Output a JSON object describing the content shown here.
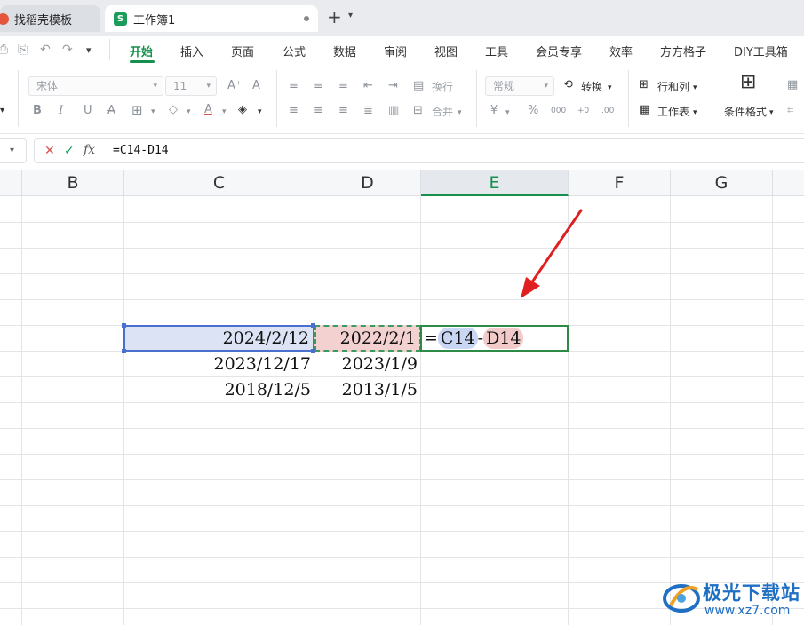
{
  "tabs": [
    {
      "label": "找稻壳模板"
    },
    {
      "label": "工作簿1",
      "icon_text": "S"
    }
  ],
  "menu": [
    "开始",
    "插入",
    "页面",
    "公式",
    "数据",
    "审阅",
    "视图",
    "工具",
    "会员专享",
    "效率",
    "方方格子",
    "DIY工具箱"
  ],
  "ribbon": {
    "font_name": "宋体",
    "font_size": "11",
    "wrap_label": "换行",
    "merge_label": "合并",
    "number_format": "常规",
    "convert_label": "转换",
    "rowcol_label": "行和列",
    "sheet_label": "工作表",
    "cond_format_label": "条件格式",
    "bold": "B",
    "italic": "I",
    "underline": "U",
    "strike": "A",
    "font_grow": "A⁺",
    "font_shrink": "A⁻",
    "currency": "¥",
    "percent": "%",
    "thousands": "000",
    "dec_inc": "+0",
    "dec_dec": ".00"
  },
  "formula_bar": {
    "cancel": "✕",
    "confirm": "✓",
    "fx": "fx",
    "formula": "=C14-D14"
  },
  "columns": [
    "B",
    "C",
    "D",
    "E",
    "F",
    "G"
  ],
  "active_column": "E",
  "cells": {
    "c14": "2024/2/12",
    "d14": "2022/2/1",
    "c15": "2023/12/17",
    "d15": "2023/1/9",
    "c16": "2018/12/5",
    "d16": "2013/1/5"
  },
  "edit_formula": {
    "eq": "=",
    "ref1": "C14",
    "op": "-",
    "ref2": "D14"
  },
  "watermark": {
    "title": "极光下载站",
    "url": "www.xz7.com"
  },
  "colors": {
    "accent": "#17904e",
    "selection": "#4a6fcf",
    "ref_fill": "#f3d1d1",
    "arrow": "#e02020"
  }
}
